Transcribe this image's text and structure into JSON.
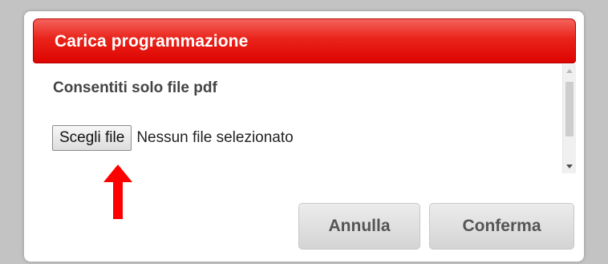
{
  "dialog": {
    "title": "Carica programmazione",
    "subtitle": "Consentiti solo file pdf",
    "file_input": {
      "button_label": "Scegli file",
      "status_text": "Nessun file selezionato"
    },
    "buttons": {
      "cancel_label": "Annulla",
      "confirm_label": "Conferma"
    }
  },
  "colors": {
    "title_bar": "#e9231a",
    "annotation_arrow": "#ff0000"
  },
  "icons": {
    "annotation": "red-arrow-up-icon"
  }
}
